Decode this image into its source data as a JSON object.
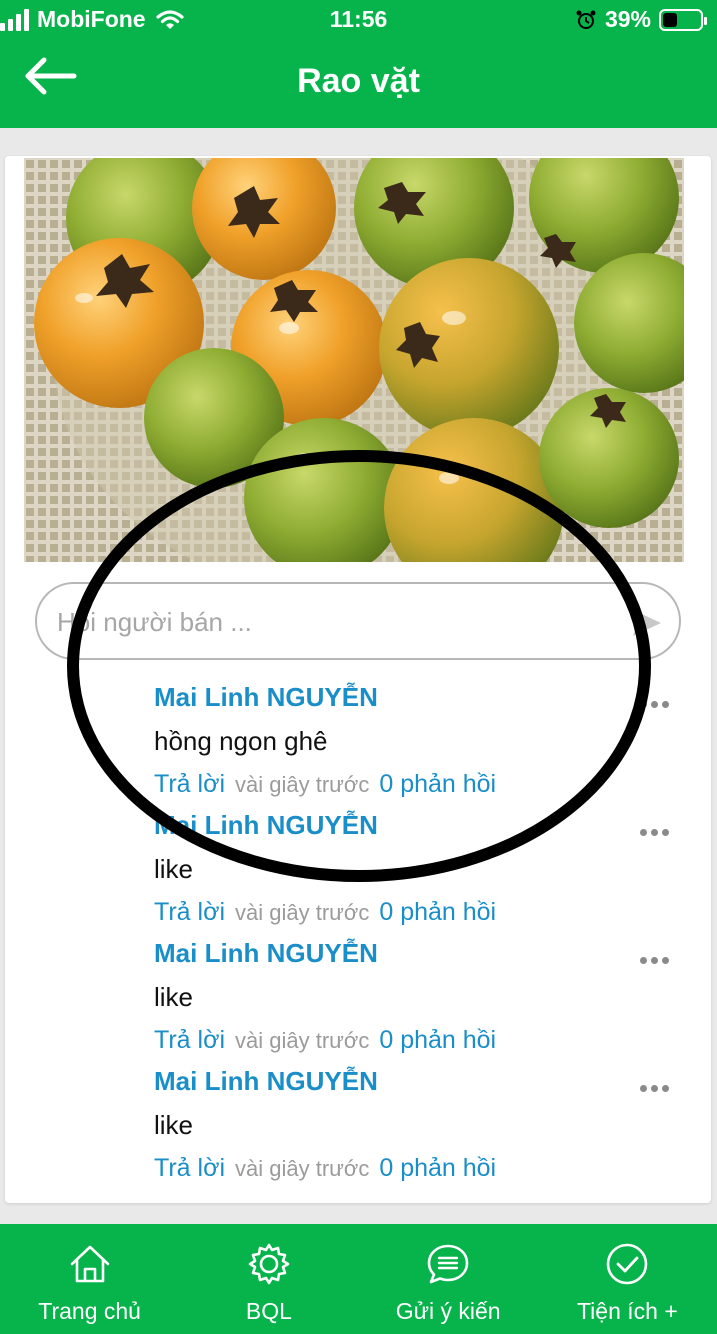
{
  "status_bar": {
    "carrier": "MobiFone",
    "time": "11:56",
    "battery_percent": "39%",
    "battery_level": 0.39
  },
  "header": {
    "title": "Rao vặt",
    "back_icon": "arrow-left-icon"
  },
  "listing": {
    "photo": "persimmons-in-basket"
  },
  "ask_seller": {
    "placeholder": "Hỏi người bán ...",
    "value": "",
    "send_icon": "send-icon"
  },
  "comments": [
    {
      "author": "Mai Linh NGUYỄN",
      "text": "hồng ngon ghê",
      "reply_label": "Trả lời",
      "time": "vài giây trước",
      "replies_label": "0 phản hồi"
    },
    {
      "author": "Mai Linh NGUYỄN",
      "text": "like",
      "reply_label": "Trả lời",
      "time": "vài giây trước",
      "replies_label": "0 phản hồi"
    },
    {
      "author": "Mai Linh NGUYỄN",
      "text": "like",
      "reply_label": "Trả lời",
      "time": "vài giây trước",
      "replies_label": "0 phản hồi"
    },
    {
      "author": "Mai Linh NGUYỄN",
      "text": "like",
      "reply_label": "Trả lời",
      "time": "vài giây trước",
      "replies_label": "0 phản hồi"
    }
  ],
  "tabbar": {
    "items": [
      {
        "label": "Trang chủ",
        "icon": "home-icon"
      },
      {
        "label": "BQL",
        "icon": "gear-icon"
      },
      {
        "label": "Gửi ý kiến",
        "icon": "chat-bubble-icon"
      },
      {
        "label": "Tiện ích +",
        "icon": "check-circle-icon"
      }
    ]
  },
  "colors": {
    "brand_green": "#07b44b",
    "link_blue": "#1a8ec8",
    "muted_gray": "#9b9b9b"
  }
}
